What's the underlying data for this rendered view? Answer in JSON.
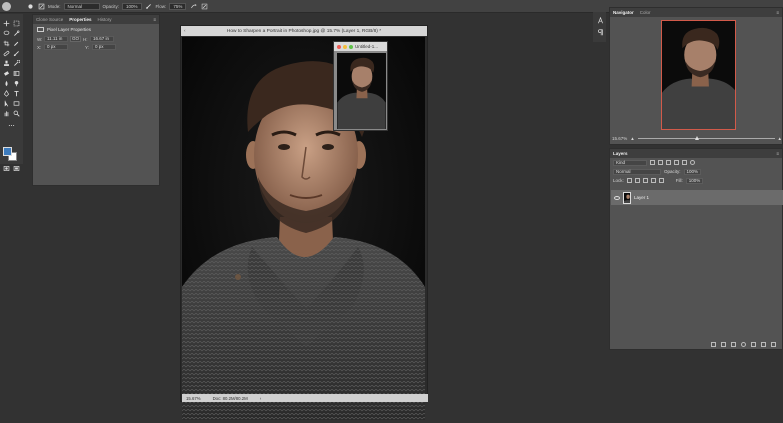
{
  "options_bar": {
    "mode_label": "Mode:",
    "mode_value": "Normal",
    "opacity_label": "Opacity:",
    "opacity_value": "100%",
    "flow_label": "Flow:",
    "flow_value": "75%"
  },
  "props_panel": {
    "tabs": [
      "Clone Source",
      "Properties",
      "History"
    ],
    "active_tab": "Properties",
    "title": "Pixel Layer Properties",
    "w_label": "W:",
    "w_value": "11.11 in",
    "go_label": "GO",
    "h_label": "H:",
    "h_value": "16.67 in",
    "x_label": "X:",
    "x_value": "0 px",
    "y_label": "Y:",
    "y_value": "0 px"
  },
  "document": {
    "title": "How to Sharpen a Portrait in Photoshop.jpg @ 15.7% (Layer 1, RGB/8) *",
    "zoom": "15.67%",
    "doc_size": "Doc: 80.2M/80.2M"
  },
  "popup": {
    "title": "Untitled-1..."
  },
  "navigator": {
    "tabs": [
      "Navigator",
      "Color"
    ],
    "zoom": "15.67%"
  },
  "layers": {
    "title": "Layers",
    "kind_value": "Kind",
    "blend_value": "Normal",
    "opacity_label": "Opacity:",
    "opacity_value": "100%",
    "lock_label": "Lock:",
    "fill_label": "Fill:",
    "fill_value": "100%",
    "layer_name": "Layer 1"
  },
  "colors": {
    "foreground": "#3c7bbd",
    "background": "#ffffff",
    "nav_frame": "#d25a4a"
  }
}
